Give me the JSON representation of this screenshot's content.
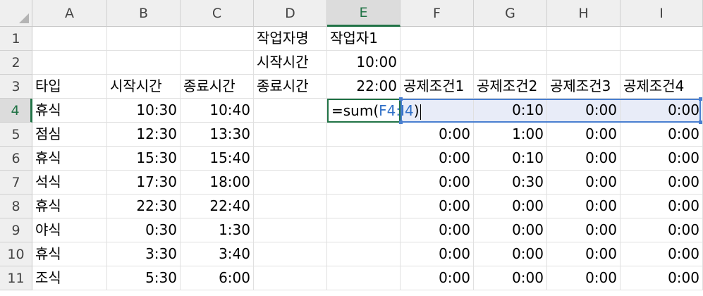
{
  "columns": [
    "A",
    "B",
    "C",
    "D",
    "E",
    "F",
    "G",
    "H",
    "I"
  ],
  "active_column": "E",
  "rows": [
    "1",
    "2",
    "3",
    "4",
    "5",
    "6",
    "7",
    "8",
    "9",
    "10",
    "11"
  ],
  "active_row": "4",
  "cells": {
    "D1": "작업자명",
    "E1": "작업자1",
    "D2": "시작시간",
    "E2": "10:00",
    "A3": "타입",
    "B3": "시작시간",
    "C3": "종료시간",
    "D3": "종료시간",
    "E3": "22:00",
    "F3": "공제조건1",
    "G3": "공제조건2",
    "H3": "공제조건3",
    "I3": "공제조건4",
    "A4": "휴식",
    "B4": "10:30",
    "C4": "10:40",
    "G4": "0:10",
    "H4": "0:00",
    "I4": "0:00",
    "A5": "점심",
    "B5": "12:30",
    "C5": "13:30",
    "F5": "0:00",
    "G5": "1:00",
    "H5": "0:00",
    "I5": "0:00",
    "A6": "휴식",
    "B6": "15:30",
    "C6": "15:40",
    "F6": "0:00",
    "G6": "0:10",
    "H6": "0:00",
    "I6": "0:00",
    "A7": "석식",
    "B7": "17:30",
    "C7": "18:00",
    "F7": "0:00",
    "G7": "0:30",
    "H7": "0:00",
    "I7": "0:00",
    "A8": "휴식",
    "B8": "22:30",
    "C8": "22:40",
    "F8": "0:00",
    "G8": "0:00",
    "H8": "0:00",
    "I8": "0:00",
    "A9": "야식",
    "B9": "0:30",
    "C9": "1:30",
    "F9": "0:00",
    "G9": "0:00",
    "H9": "0:00",
    "I9": "0:00",
    "A10": "휴식",
    "B10": "3:30",
    "C10": "3:40",
    "F10": "0:00",
    "G10": "0:00",
    "H10": "0:00",
    "I10": "0:00",
    "A11": "조식",
    "B11": "5:30",
    "C11": "6:00",
    "F11": "0:00",
    "G11": "0:00",
    "H11": "0:00",
    "I11": "0:00"
  },
  "formula": {
    "prefix": "=sum(",
    "range": "F4:I4",
    "suffix": ")"
  },
  "colors": {
    "header_bg": "#efefef",
    "active_accent": "#217346",
    "range_blue": "#4a7fd0",
    "range_fill": "#e8ecf8"
  }
}
